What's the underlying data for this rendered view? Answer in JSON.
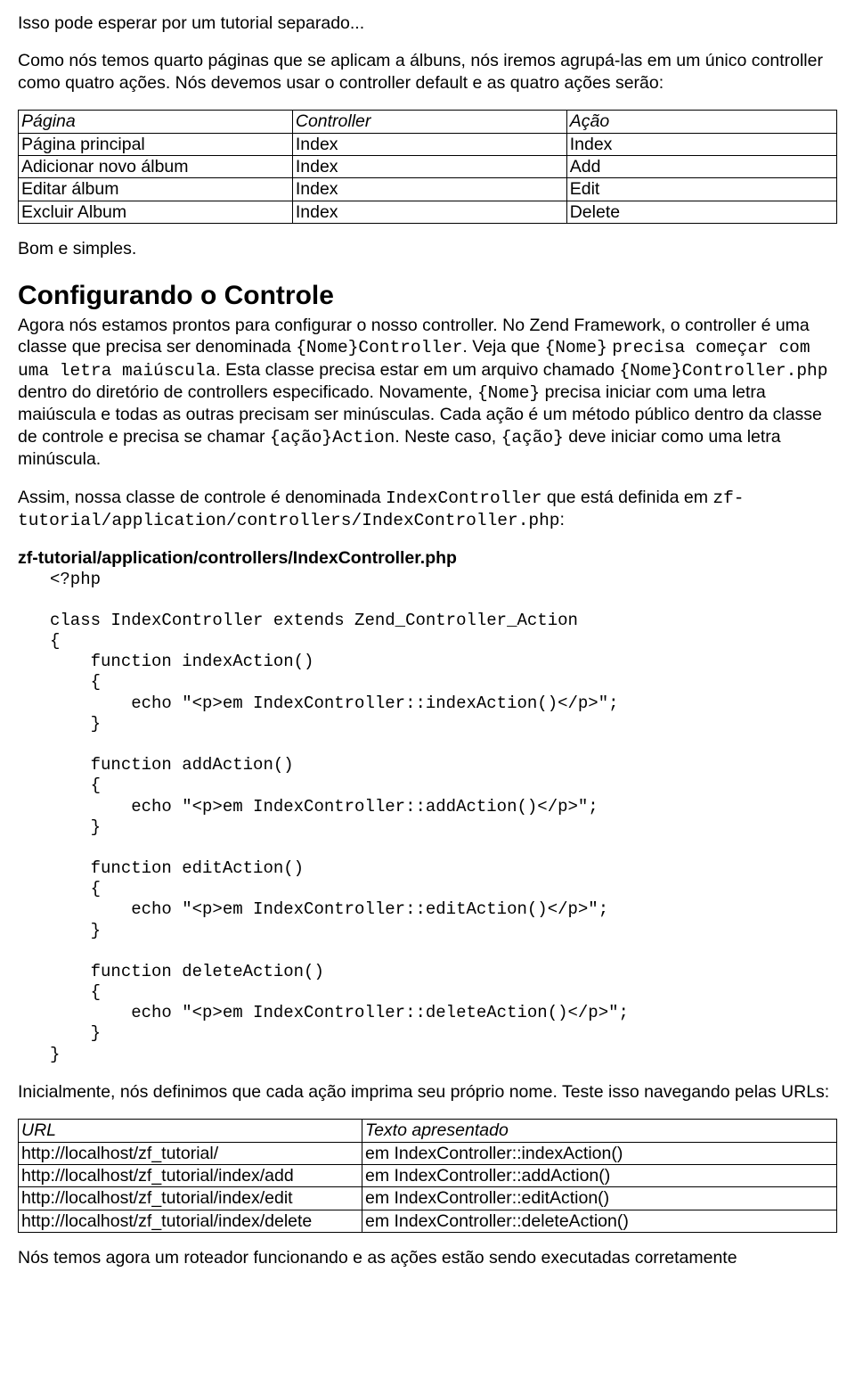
{
  "intro1": "Isso pode esperar por um tutorial separado...",
  "intro2": "Como nós temos quarto páginas que se aplicam a álbuns, nós iremos agrupá-las em um único controller como quatro ações. Nós devemos usar o controller default e as quatro ações serão:",
  "table1": {
    "h1": "Página",
    "h2": "Controller",
    "h3": "Ação",
    "r1c1": "Página principal",
    "r1c2": "Index",
    "r1c3": "Index",
    "r2c1": "Adicionar novo álbum",
    "r2c2": "Index",
    "r2c3": "Add",
    "r3c1": "Editar álbum",
    "r3c2": "Index",
    "r3c3": "Edit",
    "r4c1": "Excluir Album",
    "r4c2": "Index",
    "r4c3": "Delete"
  },
  "bom": "Bom e simples.",
  "h2": "Configurando o Controle",
  "conf": {
    "t1": "Agora nós estamos prontos para configurar o nosso controller. No Zend Framework, o controller é uma classe que precisa ser denominada ",
    "c1": "{Nome}Controller",
    "t2": ". Veja que ",
    "c2": "{Nome}",
    "t3": " ",
    "c3": "precisa começar com uma letra maiúscula",
    "t4": ". Esta classe precisa estar em um arquivo chamado ",
    "c4": "{Nome}Controller.php",
    "t5": " dentro do diretório de controllers especificado. Novamente, ",
    "c5": "{Nome}",
    "t6": " precisa iniciar com uma letra maiúscula e todas as outras precisam ser minúsculas. Cada ação é um método público dentro da classe de controle e precisa se chamar ",
    "c6": "{ação}Action",
    "t7": ". Neste caso, ",
    "c7": "{ação}",
    "t8": " deve iniciar como uma letra minúscula."
  },
  "assim": {
    "t1": "Assim, nossa classe de controle é denominada ",
    "c1": "IndexController",
    "t2": " que está definida em ",
    "c2": "zf-tutorial/application/controllers/IndexController.php",
    "t3": ":"
  },
  "filepath": "zf-tutorial/application/controllers/IndexController.php",
  "code": "<?php\n\nclass IndexController extends Zend_Controller_Action\n{\n    function indexAction()\n    {\n        echo \"<p>em IndexController::indexAction()</p>\";\n    }\n\n    function addAction()\n    {\n        echo \"<p>em IndexController::addAction()</p>\";\n    }\n\n    function editAction()\n    {\n        echo \"<p>em IndexController::editAction()</p>\";\n    }\n\n    function deleteAction()\n    {\n        echo \"<p>em IndexController::deleteAction()</p>\";\n    }\n}",
  "after1": "Inicialmente, nós definimos que cada ação imprima seu próprio nome. Teste isso navegando pelas URLs:",
  "table2": {
    "h1": "URL",
    "h2": "Texto apresentado",
    "r1c1": "http://localhost/zf_tutorial/",
    "r1c2": "em IndexController::indexAction()",
    "r2c1": "http://localhost/zf_tutorial/index/add",
    "r2c2": "em IndexController::addAction()",
    "r3c1": "http://localhost/zf_tutorial/index/edit",
    "r3c2": "em IndexController::editAction()",
    "r4c1": "http://localhost/zf_tutorial/index/delete",
    "r4c2": "em IndexController::deleteAction()"
  },
  "after2": "Nós temos agora um roteador funcionando e as ações estão sendo executadas corretamente"
}
